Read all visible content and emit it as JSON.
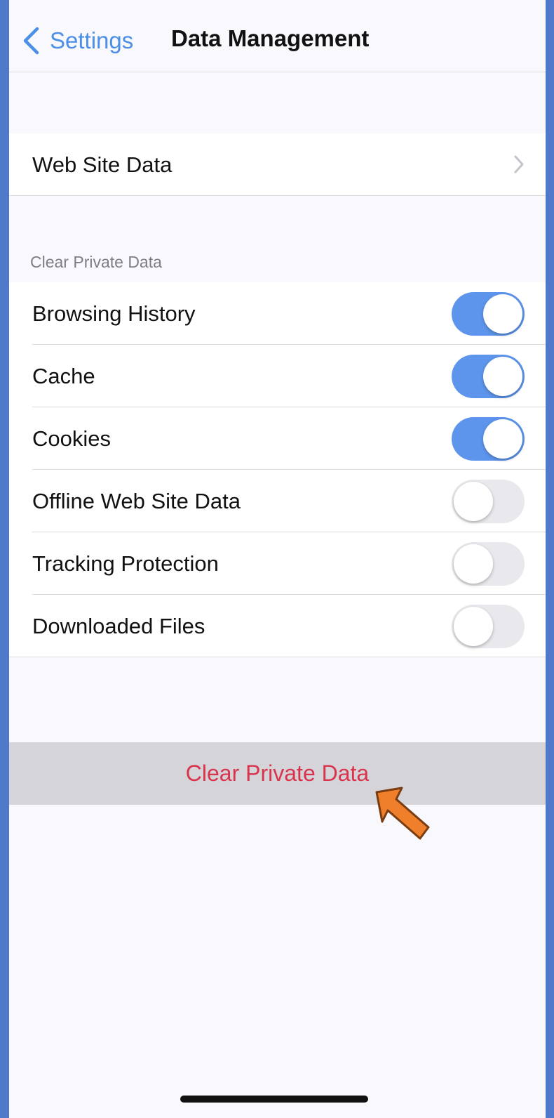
{
  "navbar": {
    "back_label": "Settings",
    "title": "Data Management"
  },
  "website_data": {
    "label": "Web Site Data"
  },
  "clear_section": {
    "header": "Clear Private Data",
    "items": [
      {
        "label": "Browsing History",
        "enabled": true
      },
      {
        "label": "Cache",
        "enabled": true
      },
      {
        "label": "Cookies",
        "enabled": true
      },
      {
        "label": "Offline Web Site Data",
        "enabled": false
      },
      {
        "label": "Tracking Protection",
        "enabled": false
      },
      {
        "label": "Downloaded Files",
        "enabled": false
      }
    ]
  },
  "clear_button": {
    "label": "Clear Private Data"
  },
  "colors": {
    "accent": "#4b8fe6",
    "toggle_on": "#5d95ec",
    "destructive": "#d9344d",
    "annotation_arrow": "#f07f2b"
  }
}
